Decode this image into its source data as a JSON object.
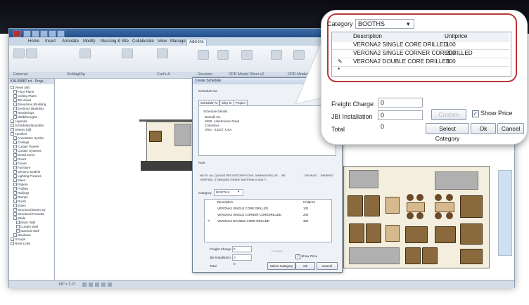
{
  "ribbon_tabs": [
    "Home",
    "Insert",
    "Annotate",
    "Modify",
    "Massing & Site",
    "Collaborate",
    "View",
    "Manage",
    "Add-Ins"
  ],
  "ribbon_groups": [
    "External",
    "RsMagDlg",
    "Carl's A",
    "Revision",
    "DPR Model Silver v2",
    "DPR Model Silver"
  ],
  "project_browser": {
    "title": "KAL00887.rvt - Proje...",
    "items": [
      "Views (all)",
      "Floor Plans",
      "Ceiling Plans",
      "3D Views",
      "Elevations (Building",
      "Sections (Building",
      "Renderings",
      "Walkthroughs",
      "Legends",
      "Schedules/Quantitie",
      "Sheets (all)",
      "Families",
      "Annotation Symbo",
      "Ceilings",
      "Curtain Panels",
      "Curtain Systems",
      "Detail Items",
      "Doors",
      "Floors",
      "Furniture",
      "Generic Models",
      "Lighting Fixtures",
      "Mass",
      "Pattern",
      "Profiles",
      "Railings",
      "Ramps",
      "Roofs",
      "Stairs",
      "Structural Beam Sy",
      "Structural Foundat",
      "Walls",
      "Basic Wall",
      "Curtain Wall",
      "Stacked Wall",
      "Windows",
      "Groups",
      "Revit Links"
    ]
  },
  "statusbar": {
    "scale": "1/8\" = 1'-0\""
  },
  "dialog": {
    "title": "Create Schedule",
    "schedule_no_label": "Schedule No.",
    "tabs": [
      "Schedule To",
      "Ship To",
      "Project"
    ],
    "details_label": "Schedule Details",
    "details_lines": [
      "Barsalli Inc.",
      "2500, Lakebourne Road",
      "Columbus",
      "Ohio - 43207, USA"
    ],
    "note_label": "Note",
    "note_text": "NOTE: ALL QUANTITIES DESCRIPTIONS, DIMENSIONS, AF ... BE VERIFIED. STANDARD GRADE MATERIALS AND F...",
    "note_text_tail": "...ER MUST ...RNISHED"
  },
  "callout": {
    "category_label": "Category",
    "category_value": "BOOTHS",
    "columns": [
      "Description",
      "Unitprice"
    ],
    "rows": [
      {
        "description": "VERONA2 SINGLE CORE DRILLED",
        "unitprice": "100"
      },
      {
        "description": "VERONA2 SINGLE CORNER COREDRILLED",
        "unitprice": "200"
      },
      {
        "description": "VERONA2 DOUBLE CORE DRILLED",
        "unitprice": "300"
      }
    ],
    "freight_label": "Freight Charge",
    "freight_value": "0",
    "jbi_label": "JBI Installation",
    "jbi_value": "0",
    "total_label": "Total",
    "total_value": "0",
    "custom_label": "Custom",
    "show_price_label": "Show Price",
    "show_price_checked": true,
    "select_category_label": "Select Category",
    "ok_label": "Ok",
    "cancel_label": "Cancel"
  }
}
